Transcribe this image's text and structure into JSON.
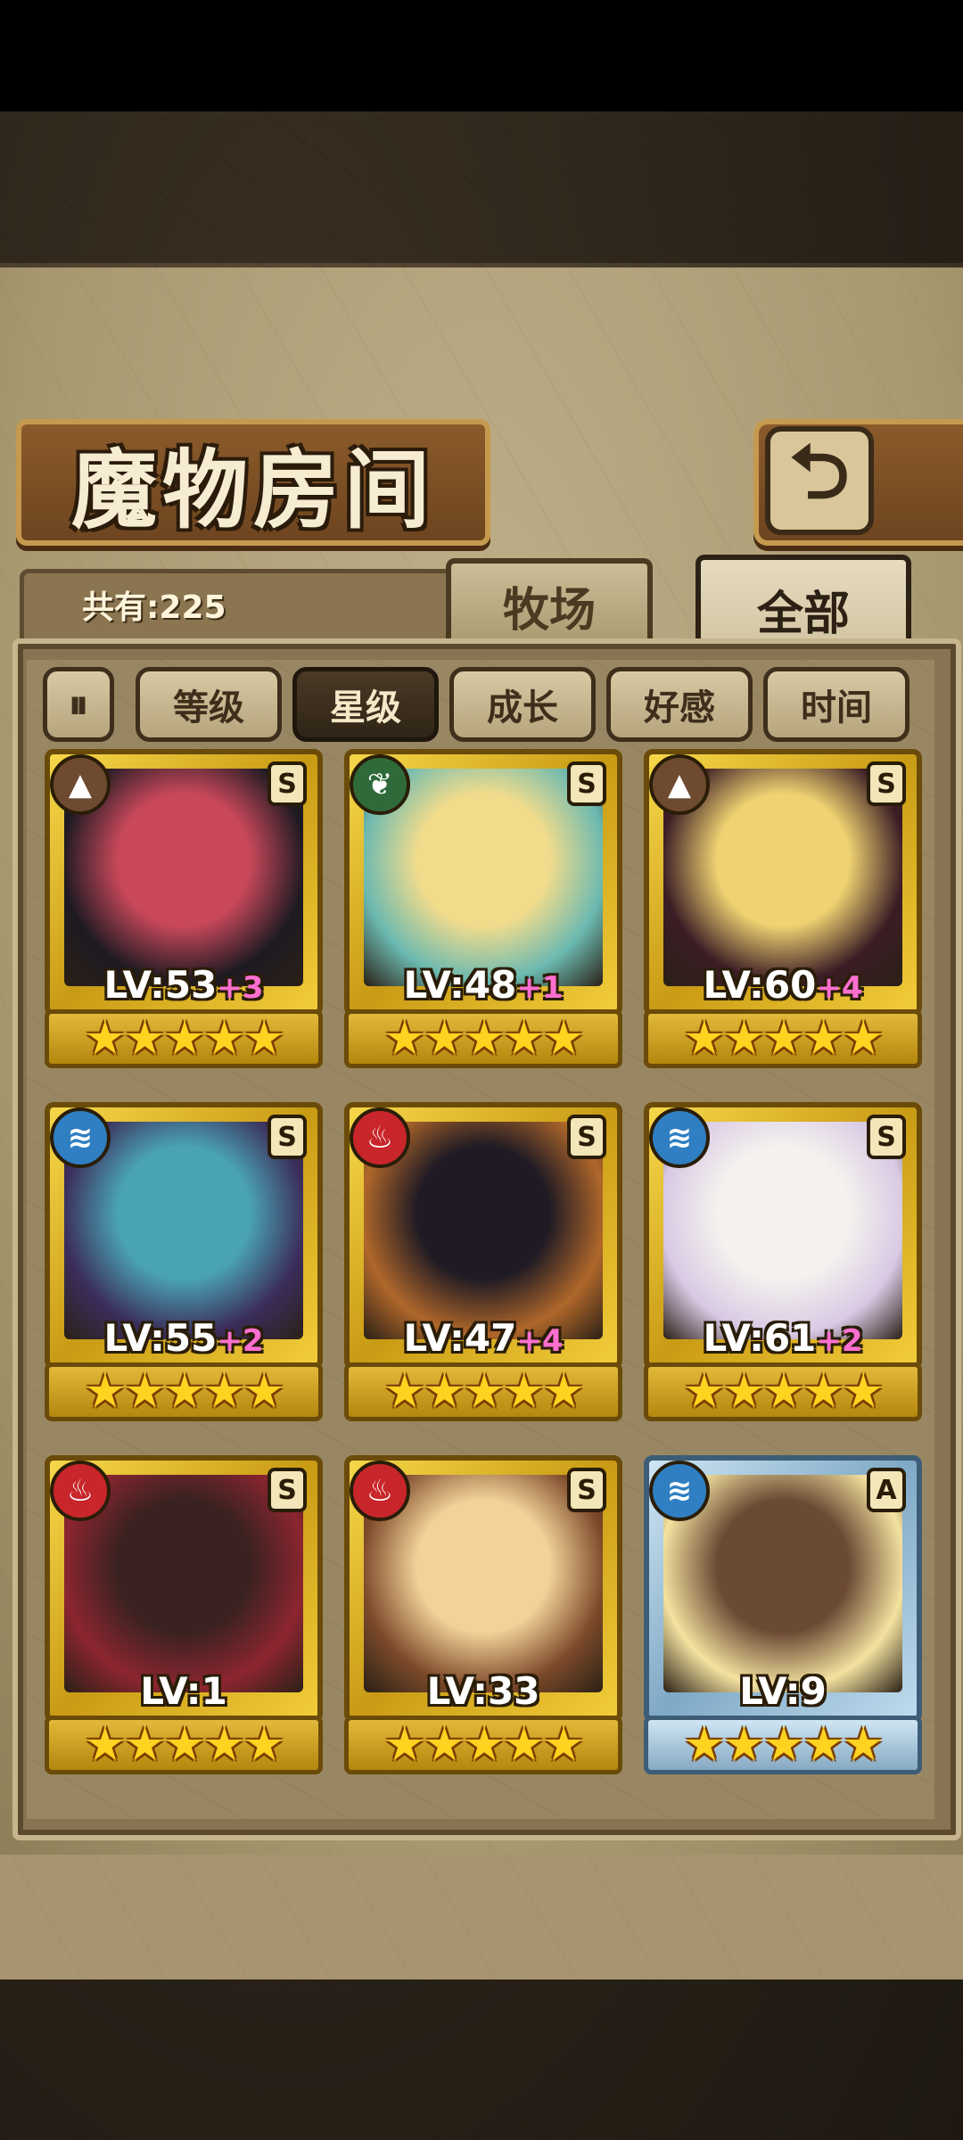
{
  "title": "魔物房间",
  "back_icon": "return-arrow-icon",
  "count_label": "共有:225",
  "tabs": [
    {
      "label": "牧场",
      "active": false
    },
    {
      "label": "全部",
      "active": true
    }
  ],
  "sort_toggle_icon": "sort-direction-icon",
  "sort_buttons": [
    {
      "label": "等级",
      "active": false
    },
    {
      "label": "星级",
      "active": true
    },
    {
      "label": "成长",
      "active": false
    },
    {
      "label": "好感",
      "active": false
    },
    {
      "label": "时间",
      "active": false
    }
  ],
  "monsters": [
    {
      "lv": "LV:53",
      "plus": "+3",
      "element": "earth",
      "element_icon": "mountain-icon",
      "rank": "S",
      "stars": "★★★★★",
      "frame": "gold",
      "colors": [
        "#c8485a",
        "#1e1a22"
      ]
    },
    {
      "lv": "LV:48",
      "plus": "+1",
      "element": "wood",
      "element_icon": "leaf-icon",
      "rank": "S",
      "stars": "★★★★★",
      "frame": "gold",
      "colors": [
        "#f1dc8c",
        "#6bb9b0"
      ]
    },
    {
      "lv": "LV:60",
      "plus": "+4",
      "element": "earth",
      "element_icon": "mountain-icon",
      "rank": "S",
      "stars": "★★★★★",
      "frame": "gold",
      "colors": [
        "#f0d272",
        "#3b1d25"
      ]
    },
    {
      "lv": "LV:55",
      "plus": "+2",
      "element": "water",
      "element_icon": "wave-icon",
      "rank": "S",
      "stars": "★★★★★",
      "frame": "gold",
      "colors": [
        "#4aa3b5",
        "#3b2d5b"
      ]
    },
    {
      "lv": "LV:47",
      "plus": "+4",
      "element": "fire",
      "element_icon": "flame-icon",
      "rank": "S",
      "stars": "★★★★★",
      "frame": "gold",
      "colors": [
        "#1f1a24",
        "#b0672a"
      ]
    },
    {
      "lv": "LV:61",
      "plus": "+2",
      "element": "water",
      "element_icon": "wave-icon",
      "rank": "S",
      "stars": "★★★★★",
      "frame": "gold",
      "colors": [
        "#f4f1ee",
        "#d9c9e4"
      ]
    },
    {
      "lv": "LV:1",
      "plus": "",
      "element": "fire",
      "element_icon": "flame-icon",
      "rank": "S",
      "stars": "★★★★★",
      "frame": "gold",
      "colors": [
        "#3a2220",
        "#8c2530"
      ]
    },
    {
      "lv": "LV:33",
      "plus": "",
      "element": "fire",
      "element_icon": "flame-icon",
      "rank": "S",
      "stars": "★★★★★",
      "frame": "gold",
      "colors": [
        "#f3d29a",
        "#7d4a2a"
      ]
    },
    {
      "lv": "LV:9",
      "plus": "",
      "element": "water",
      "element_icon": "wave-icon",
      "rank": "A",
      "stars": "★★★★★",
      "frame": "blue",
      "colors": [
        "#6b4a34",
        "#f4e2a0"
      ]
    }
  ],
  "element_colors": {
    "earth": "#6e4a30",
    "wood": "#2f6b3a",
    "water": "#2f7fc2",
    "fire": "#c8262a"
  }
}
